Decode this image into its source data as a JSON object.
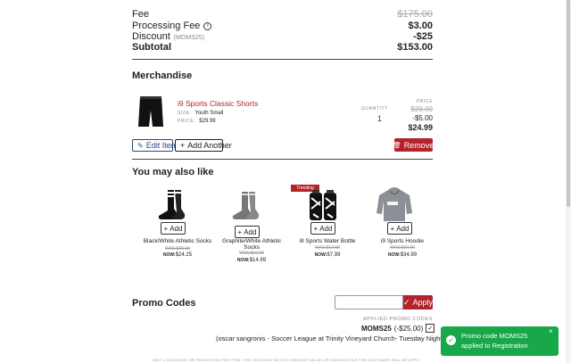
{
  "summary": {
    "fee_label": "Fee",
    "fee_value": "$175.00",
    "processing_label": "Processing Fee",
    "processing_value": "$3.00",
    "discount_label": "Discount",
    "discount_code": "(MOMS25)",
    "discount_value": "-$25",
    "subtotal_label": "Subtotal",
    "subtotal_value": "$153.00"
  },
  "merch": {
    "title": "Merchandise",
    "item_name": "i9 Sports Classic Shorts",
    "size_label": "SIZE:",
    "size_value": "Youth Small",
    "price_label": "PRICE:",
    "price_value": "$29.99",
    "qty_label": "QUANTITY",
    "qty_value": "1",
    "col_price_label": "PRICE",
    "orig_price": "$29.99",
    "discount": "-$5.00",
    "final_price": "$24.99",
    "edit_label": "Edit Item",
    "add_another_label": "Add Another",
    "remove_label": "Remove"
  },
  "recommend": {
    "title": "You may also like",
    "trending_badge": "Trending",
    "add_label": "Add",
    "products": [
      {
        "name": "Black/White Athletic Socks",
        "was": "WAS:$29.99",
        "now_label": "NOW:",
        "now": "$24.25"
      },
      {
        "name": "Graphite/White Athletic Socks",
        "was": "WAS:$19.99",
        "now_label": "NOW:",
        "now": "$14.99"
      },
      {
        "name": "i9 Sports Water Bottle",
        "was": "WAS:$12.99",
        "now_label": "NOW:",
        "now": "$7.99"
      },
      {
        "name": "i9 Sports Hoodie",
        "was": "WAS:$39.99",
        "now_label": "NOW:",
        "now": "$34.99"
      }
    ]
  },
  "promo": {
    "title": "Promo Codes",
    "input_value": "",
    "apply_label": "Apply",
    "applied_label": "APPLIED PROMO CODES",
    "applied_code": "MOMS25",
    "applied_amount": "(-$25.00)",
    "applied_desc": "(oscar sangronis - Soccer League at Trinity Vineyard Church- Tuesday Night)",
    "footer_note": "LIMIT 1 DISCOUNT OR PROMOTION PER ITEM. THE DISCOUNT WITH A GREATER VALUE OR SAVINGS FOR THE CUSTOMER WILL BE APPLIED."
  },
  "toast": {
    "message": "Promo code MOMS25 applied to Registration"
  },
  "colors": {
    "accent_red": "#b3232c",
    "navy": "#2a4a7a",
    "toast_green": "#18a84a"
  }
}
